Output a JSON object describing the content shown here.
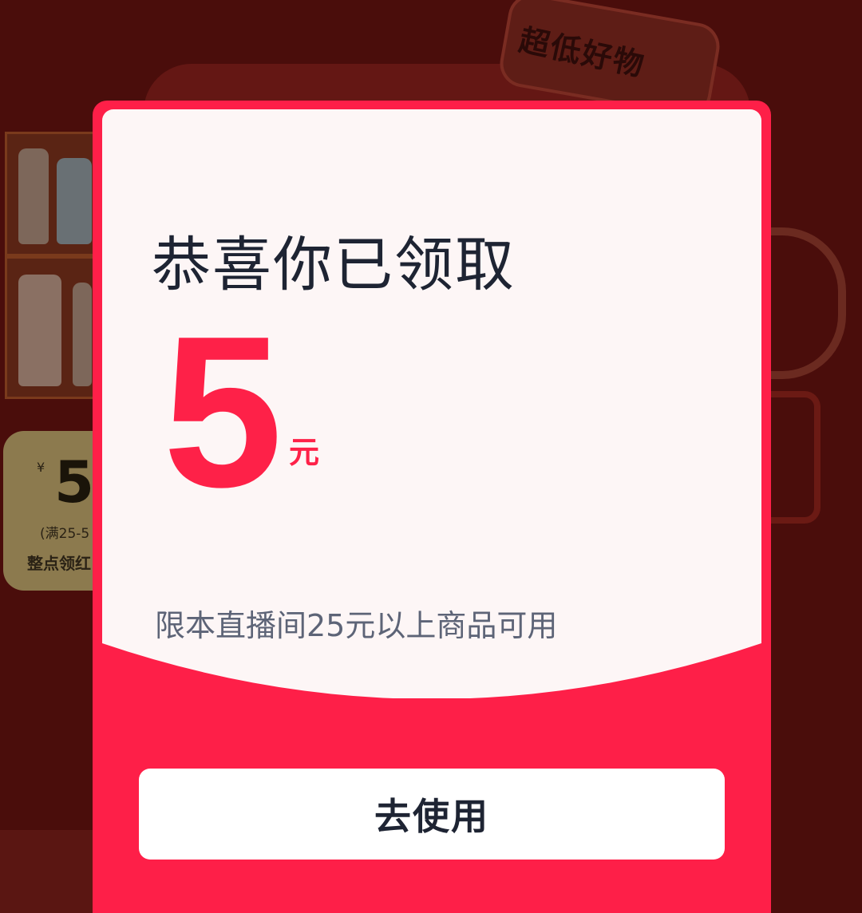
{
  "background": {
    "banner_text": "超低好物",
    "coupon_preview": {
      "currency": "¥",
      "amount": "5",
      "condition": "(满25-5",
      "tag": "整点领红"
    }
  },
  "modal": {
    "title": "恭喜你已领取",
    "amount": "5",
    "unit": "元",
    "condition": "限本直播间25元以上商品可用",
    "use_button_label": "去使用"
  },
  "colors": {
    "accent": "#fe1f48",
    "card_bg": "#fdf6f6",
    "title_text": "#1e2433",
    "condition_text": "#5d6477",
    "button_bg": "#ffffff"
  }
}
